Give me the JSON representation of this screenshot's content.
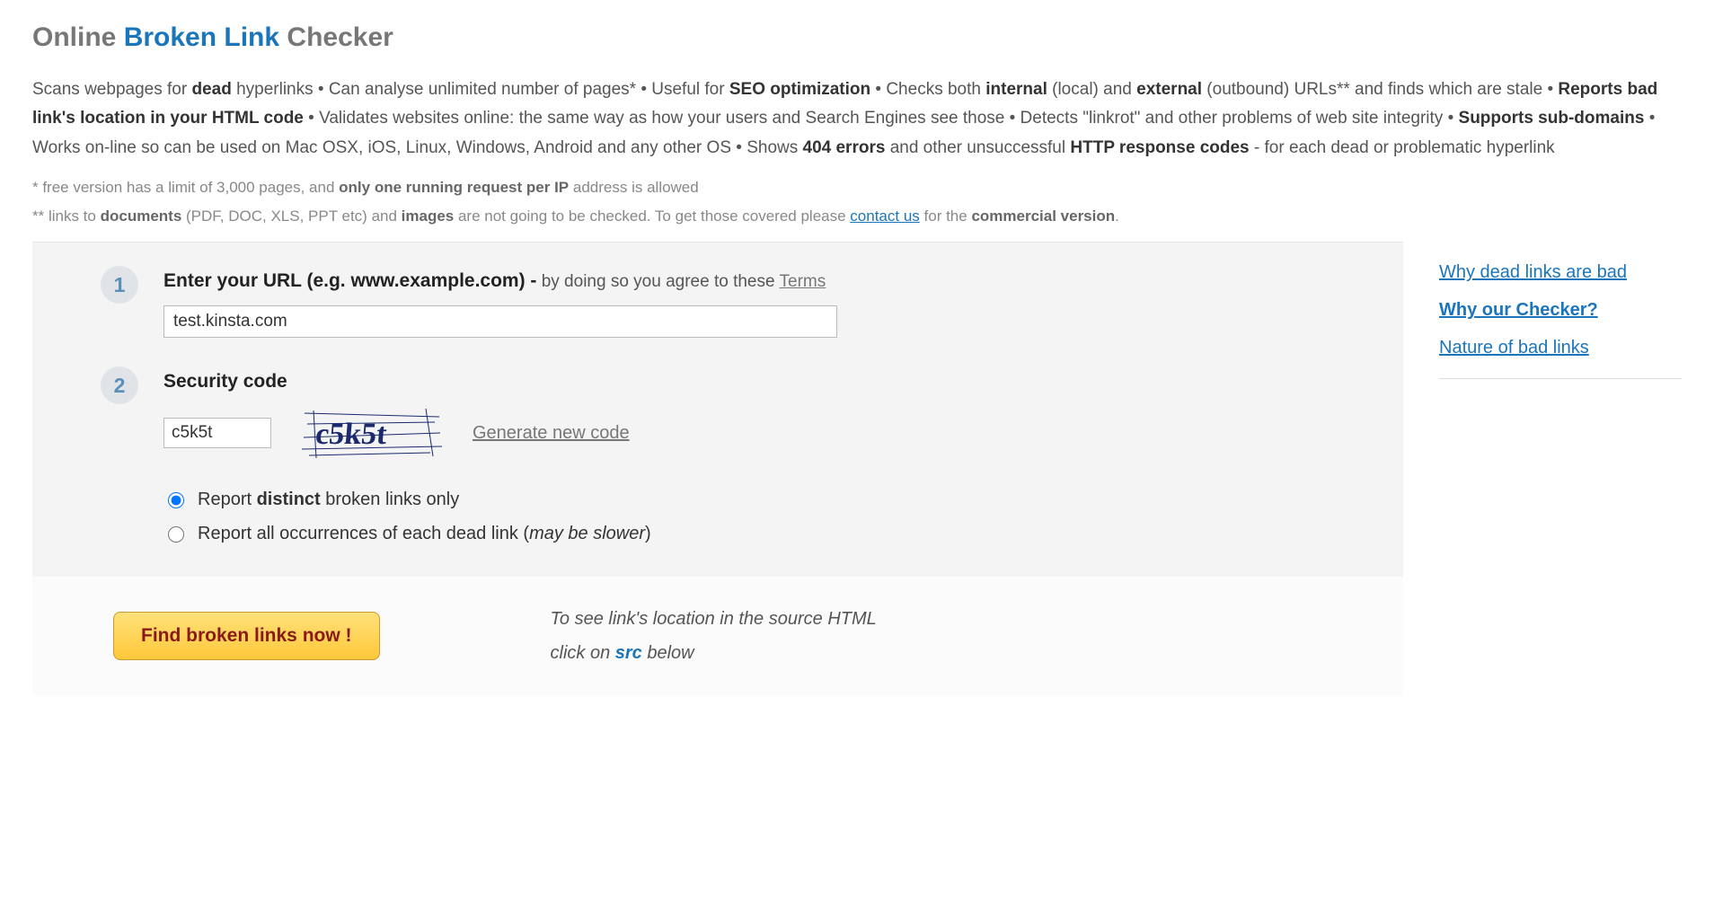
{
  "title": {
    "part1": "Online ",
    "part2": "Broken Link",
    "part3": " Checker"
  },
  "intro": {
    "t1": "Scans webpages for ",
    "b1": "dead",
    "t2": " hyperlinks • Can analyse unlimited number of pages* • Useful for ",
    "b2": "SEO optimization",
    "t3": " • Checks both ",
    "b3": "internal",
    "t4": " (local) and ",
    "b4": "external",
    "t5": " (outbound) URLs** and finds which are stale • ",
    "b5": "Reports bad link's location in your HTML code",
    "t6": " • Validates websites online: the same way as how your users and Search Engines see those • Detects \"linkrot\" and other problems of web site integrity • ",
    "b6": "Supports sub-domains",
    "t7": " • Works on-line so can be used on Mac OSX, iOS, Linux, Windows, Android and any other OS • Shows ",
    "b7": "404 errors",
    "t8": " and other unsuccessful ",
    "b8": "HTTP response codes",
    "t9": " - for each dead or problematic hyperlink"
  },
  "notes": {
    "n1a": "*  free version has a limit of 3,000 pages, and ",
    "n1b": "only one running request per IP",
    "n1c": " address is allowed",
    "n2a": "** links to ",
    "n2b": "documents",
    "n2c": " (PDF, DOC, XLS, PPT etc) and ",
    "n2d": "images",
    "n2e": " are not going to be checked. To get those covered please ",
    "n2link": "contact us",
    "n2f": " for the ",
    "n2g": "commercial version",
    "n2h": "."
  },
  "form": {
    "step1_num": "1",
    "step1_label_a": "Enter your URL (e.g. ",
    "step1_label_b": "www.example.com",
    "step1_label_c": ") -",
    "step1_hint": " by doing so you agree to these ",
    "step1_terms": "Terms",
    "url_value": "test.kinsta.com",
    "step2_num": "2",
    "step2_label": "Security code",
    "code_value": "c5k5t",
    "captcha_text": "c5k5t",
    "gen_new": "Generate new code",
    "radio1_a": "Report ",
    "radio1_b": "distinct",
    "radio1_c": " broken links only",
    "radio2_a": "Report all occurrences of each dead link (",
    "radio2_b": "may be slower",
    "radio2_c": ")"
  },
  "submit": {
    "button": "Find broken links now !",
    "hint_a": "To see link's location in the source HTML",
    "hint_b": "click on ",
    "hint_src": "src",
    "hint_c": " below"
  },
  "sidebar": {
    "link1": "Why dead links are bad",
    "link2": "Why our Checker?",
    "link3": "Nature of bad links"
  }
}
